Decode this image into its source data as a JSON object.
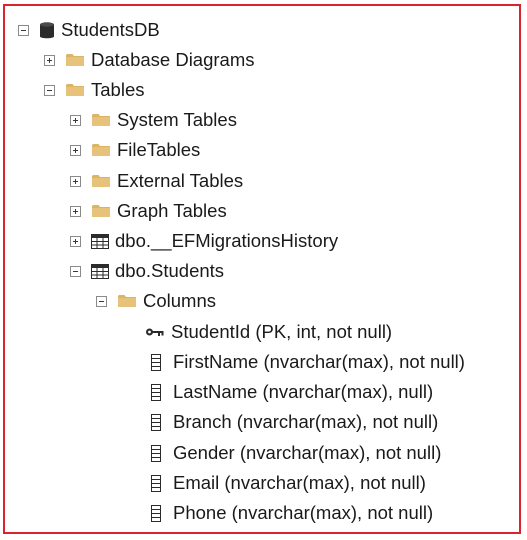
{
  "colors": {
    "frame_border": "#d9232e",
    "folder": "#dcb464",
    "text": "#1a1a1a"
  },
  "tree": {
    "root": {
      "label": "StudentsDB",
      "icon": "database-icon",
      "expanded": true
    },
    "database_diagrams": {
      "label": "Database Diagrams",
      "icon": "folder-icon",
      "expanded": false
    },
    "tables": {
      "label": "Tables",
      "icon": "folder-icon",
      "expanded": true
    },
    "system_tables": {
      "label": "System Tables",
      "icon": "folder-icon",
      "expanded": false
    },
    "file_tables": {
      "label": "FileTables",
      "icon": "folder-icon",
      "expanded": false
    },
    "external_tables": {
      "label": "External Tables",
      "icon": "folder-icon",
      "expanded": false
    },
    "graph_tables": {
      "label": "Graph Tables",
      "icon": "folder-icon",
      "expanded": false
    },
    "ef_migrations": {
      "label": "dbo.__EFMigrationsHistory",
      "icon": "table-icon",
      "expanded": false
    },
    "students": {
      "label": "dbo.Students",
      "icon": "table-icon",
      "expanded": true
    },
    "columns": {
      "label": "Columns",
      "icon": "folder-icon",
      "expanded": true
    },
    "column_items": [
      {
        "label": "StudentId (PK, int, not null)",
        "icon": "key-icon"
      },
      {
        "label": "FirstName (nvarchar(max), not null)",
        "icon": "column-icon"
      },
      {
        "label": "LastName (nvarchar(max), null)",
        "icon": "column-icon"
      },
      {
        "label": "Branch (nvarchar(max), not null)",
        "icon": "column-icon"
      },
      {
        "label": "Gender (nvarchar(max), not null)",
        "icon": "column-icon"
      },
      {
        "label": "Email (nvarchar(max), not null)",
        "icon": "column-icon"
      },
      {
        "label": "Phone (nvarchar(max), not null)",
        "icon": "column-icon"
      }
    ]
  }
}
